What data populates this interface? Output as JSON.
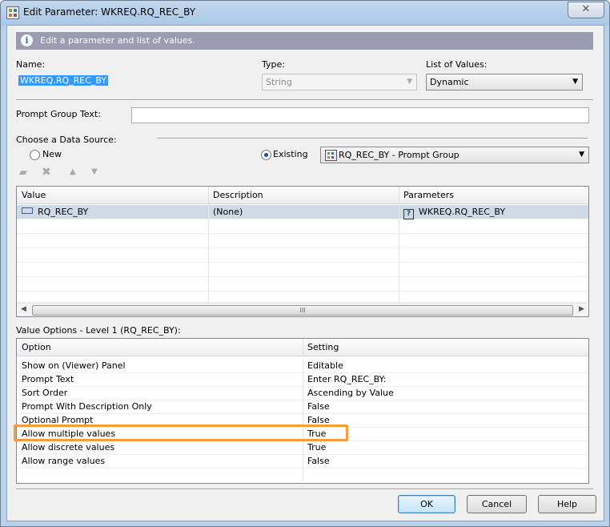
{
  "window": {
    "title": "Edit Parameter: WKREQ.RQ_REC_BY",
    "close_glyph": "✕"
  },
  "info": {
    "text": "Edit a parameter and list of values.",
    "icon": "info-icon"
  },
  "name": {
    "label": "Name:",
    "value": "WKREQ.RQ_REC_BY"
  },
  "type": {
    "label": "Type:",
    "value": "String"
  },
  "lov": {
    "label": "List of Values:",
    "value": "Dynamic"
  },
  "prompt_group": {
    "label": "Prompt Group Text:",
    "value": ""
  },
  "datasource": {
    "label": "Choose a Data Source:",
    "new_label": "New",
    "existing_label": "Existing",
    "selected": "existing",
    "value": "RQ_REC_BY - Prompt Group"
  },
  "values_grid": {
    "columns": [
      "Value",
      "Description",
      "Parameters"
    ],
    "rows": [
      {
        "value": "RQ_REC_BY",
        "description": "(None)",
        "parameters": "WKREQ.RQ_REC_BY"
      }
    ],
    "scroll_thumb": "III"
  },
  "options": {
    "label": "Value Options - Level 1 (RQ_REC_BY):",
    "columns": [
      "Option",
      "Setting"
    ],
    "rows": [
      {
        "option": "Show on (Viewer) Panel",
        "setting": "Editable"
      },
      {
        "option": "Prompt Text",
        "setting": "Enter RQ_REC_BY:"
      },
      {
        "option": "Sort Order",
        "setting": "Ascending by Value"
      },
      {
        "option": "Prompt With Description Only",
        "setting": "False"
      },
      {
        "option": "Optional Prompt",
        "setting": "False"
      },
      {
        "option": "Allow multiple values",
        "setting": "True"
      },
      {
        "option": "Allow discrete values",
        "setting": "True"
      },
      {
        "option": "Allow range values",
        "setting": "False"
      }
    ],
    "highlight_color": "#f79c3c"
  },
  "buttons": {
    "ok": "OK",
    "cancel": "Cancel",
    "help": "Help"
  }
}
